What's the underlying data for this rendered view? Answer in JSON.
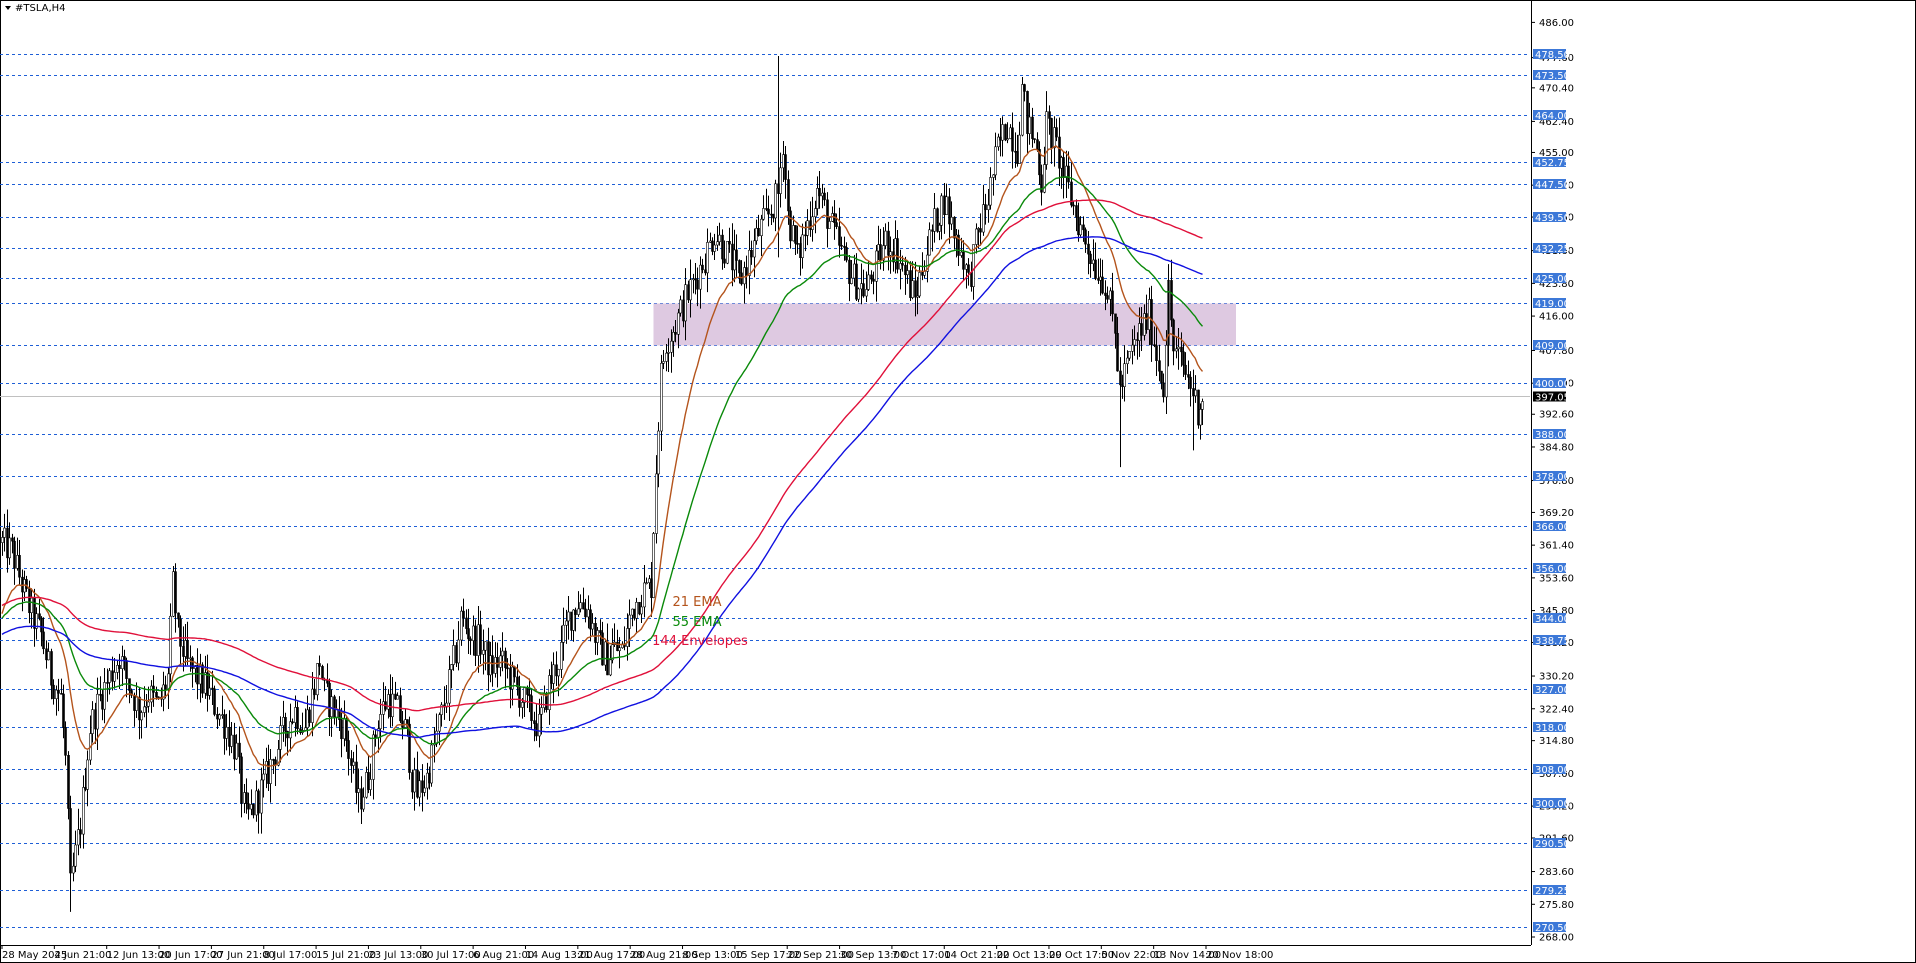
{
  "window": {
    "title": "#TSLA,H4",
    "collapse_icon": "triangle-down-icon"
  },
  "colors": {
    "candle": "#000000",
    "grid_level": "#1e5fd6",
    "ema21": "#b4541c",
    "ema55": "#0a8a0a",
    "env_upper": "#e0103a",
    "env_lower": "#1010e0",
    "zone_fill": "#d8bfdc",
    "level_tag_bg": "#3c78d8",
    "current_tag_bg": "#000000"
  },
  "legend": [
    {
      "label": "21 EMA",
      "color": "#b4541c"
    },
    {
      "label": "55 EMA",
      "color": "#0a8a0a"
    },
    {
      "label": "144 Envelopes",
      "color": "#e0103a"
    }
  ],
  "chart_data": {
    "type": "candlestick",
    "title": "#TSLA,H4",
    "ylim": [
      268.0,
      488.0
    ],
    "y_ticks": [
      "486.00",
      "477.60",
      "470.40",
      "462.40",
      "455.00",
      "447.20",
      "439.60",
      "431.60",
      "423.80",
      "416.00",
      "407.80",
      "400.00",
      "392.60",
      "384.80",
      "376.80",
      "369.20",
      "361.40",
      "353.60",
      "345.80",
      "338.20",
      "330.20",
      "322.40",
      "314.80",
      "307.00",
      "299.20",
      "291.60",
      "283.60",
      "275.80",
      "268.00"
    ],
    "y_tick_values": [
      486.0,
      477.6,
      470.4,
      462.4,
      455.0,
      447.2,
      439.6,
      431.6,
      423.8,
      416.0,
      407.8,
      400.0,
      392.6,
      384.8,
      376.8,
      369.2,
      361.4,
      353.6,
      345.8,
      338.2,
      330.2,
      322.4,
      314.8,
      307.0,
      299.2,
      291.6,
      283.6,
      275.8,
      268.0
    ],
    "x_labels": [
      "28 May 2025",
      "4 Jun 21:00",
      "12 Jun 13:00",
      "20 Jun 17:00",
      "27 Jun 21:00",
      "8 Jul 17:00",
      "15 Jul 21:00",
      "23 Jul 13:00",
      "30 Jul 17:00",
      "6 Aug 21:00",
      "14 Aug 13:00",
      "21 Aug 17:00",
      "28 Aug 21:00",
      "8 Sep 13:00",
      "15 Sep 17:00",
      "22 Sep 21:00",
      "30 Sep 13:00",
      "7 Oct 17:00",
      "14 Oct 21:00",
      "22 Oct 13:00",
      "29 Oct 17:00",
      "5 Nov 22:00",
      "13 Nov 14:00",
      "20 Nov 18:00"
    ],
    "horizontal_levels": [
      "478.50",
      "473.50",
      "464.00",
      "452.75",
      "447.50",
      "439.50",
      "432.25",
      "425.00",
      "419.00",
      "409.00",
      "400.00",
      "388.00",
      "378.00",
      "366.00",
      "356.00",
      "344.00",
      "338.75",
      "327.00",
      "318.00",
      "308.00",
      "300.00",
      "290.50",
      "279.25",
      "270.50"
    ],
    "horizontal_level_values": [
      478.5,
      473.5,
      464.0,
      452.75,
      447.5,
      439.5,
      432.25,
      425.0,
      419.0,
      409.0,
      400.0,
      388.0,
      378.0,
      366.0,
      356.0,
      344.0,
      338.75,
      327.0,
      318.0,
      308.0,
      300.0,
      290.5,
      279.25,
      270.5
    ],
    "current_price": "397.05",
    "current_price_value": 397.05,
    "zone": {
      "from_label": "15 Sep 17:00",
      "to_label": "20 Nov 18:00",
      "low": 409.0,
      "high": 419.0
    },
    "price_path": [
      [
        0,
        362
      ],
      [
        4,
        360
      ],
      [
        8,
        352
      ],
      [
        12,
        345
      ],
      [
        16,
        340
      ],
      [
        20,
        330
      ],
      [
        24,
        325
      ],
      [
        26,
        310
      ],
      [
        28,
        280
      ],
      [
        32,
        295
      ],
      [
        36,
        318
      ],
      [
        40,
        325
      ],
      [
        44,
        330
      ],
      [
        48,
        335
      ],
      [
        52,
        328
      ],
      [
        56,
        322
      ],
      [
        60,
        326
      ],
      [
        64,
        323
      ],
      [
        68,
        330
      ],
      [
        70,
        352
      ],
      [
        72,
        340
      ],
      [
        76,
        333
      ],
      [
        80,
        330
      ],
      [
        84,
        327
      ],
      [
        88,
        322
      ],
      [
        92,
        318
      ],
      [
        96,
        312
      ],
      [
        98,
        302
      ],
      [
        100,
        296
      ],
      [
        104,
        300
      ],
      [
        108,
        306
      ],
      [
        112,
        312
      ],
      [
        116,
        318
      ],
      [
        120,
        322
      ],
      [
        124,
        318
      ],
      [
        128,
        328
      ],
      [
        130,
        334
      ],
      [
        132,
        326
      ],
      [
        136,
        322
      ],
      [
        140,
        318
      ],
      [
        144,
        306
      ],
      [
        146,
        300
      ],
      [
        150,
        306
      ],
      [
        154,
        320
      ],
      [
        158,
        325
      ],
      [
        162,
        322
      ],
      [
        166,
        316
      ],
      [
        168,
        306
      ],
      [
        170,
        302
      ],
      [
        174,
        306
      ],
      [
        178,
        316
      ],
      [
        182,
        326
      ],
      [
        186,
        336
      ],
      [
        188,
        344
      ],
      [
        192,
        340
      ],
      [
        196,
        338
      ],
      [
        200,
        332
      ],
      [
        204,
        334
      ],
      [
        208,
        330
      ],
      [
        212,
        326
      ],
      [
        216,
        322
      ],
      [
        220,
        318
      ],
      [
        224,
        328
      ],
      [
        228,
        334
      ],
      [
        232,
        344
      ],
      [
        236,
        348
      ],
      [
        240,
        346
      ],
      [
        244,
        338
      ],
      [
        248,
        334
      ],
      [
        250,
        337
      ],
      [
        254,
        336
      ],
      [
        258,
        346
      ],
      [
        262,
        350
      ],
      [
        266,
        352
      ],
      [
        268,
        380
      ],
      [
        270,
        402
      ],
      [
        272,
        410
      ],
      [
        276,
        414
      ],
      [
        280,
        420
      ],
      [
        284,
        425
      ],
      [
        288,
        430
      ],
      [
        292,
        436
      ],
      [
        296,
        432
      ],
      [
        300,
        428
      ],
      [
        302,
        424
      ],
      [
        306,
        430
      ],
      [
        310,
        436
      ],
      [
        314,
        440
      ],
      [
        318,
        445
      ],
      [
        320,
        458
      ],
      [
        322,
        440
      ],
      [
        326,
        430
      ],
      [
        330,
        438
      ],
      [
        334,
        446
      ],
      [
        338,
        440
      ],
      [
        342,
        434
      ],
      [
        346,
        428
      ],
      [
        350,
        424
      ],
      [
        354,
        422
      ],
      [
        358,
        428
      ],
      [
        362,
        434
      ],
      [
        366,
        432
      ],
      [
        370,
        426
      ],
      [
        374,
        420
      ],
      [
        378,
        430
      ],
      [
        382,
        438
      ],
      [
        386,
        444
      ],
      [
        390,
        436
      ],
      [
        394,
        430
      ],
      [
        396,
        424
      ],
      [
        400,
        436
      ],
      [
        404,
        444
      ],
      [
        408,
        456
      ],
      [
        412,
        462
      ],
      [
        416,
        456
      ],
      [
        418,
        470
      ],
      [
        420,
        462
      ],
      [
        424,
        456
      ],
      [
        426,
        448
      ],
      [
        428,
        462
      ],
      [
        432,
        456
      ],
      [
        436,
        448
      ],
      [
        440,
        440
      ],
      [
        444,
        434
      ],
      [
        448,
        428
      ],
      [
        452,
        424
      ],
      [
        456,
        412
      ],
      [
        458,
        398
      ],
      [
        462,
        406
      ],
      [
        466,
        412
      ],
      [
        470,
        416
      ],
      [
        472,
        410
      ],
      [
        474,
        404
      ],
      [
        476,
        400
      ],
      [
        478,
        422
      ],
      [
        480,
        408
      ],
      [
        484,
        404
      ],
      [
        488,
        398
      ],
      [
        490,
        394
      ],
      [
        492,
        397
      ]
    ],
    "series": [
      {
        "name": "21 EMA"
      },
      {
        "name": "55 EMA"
      },
      {
        "name": "144 Envelopes"
      }
    ]
  }
}
